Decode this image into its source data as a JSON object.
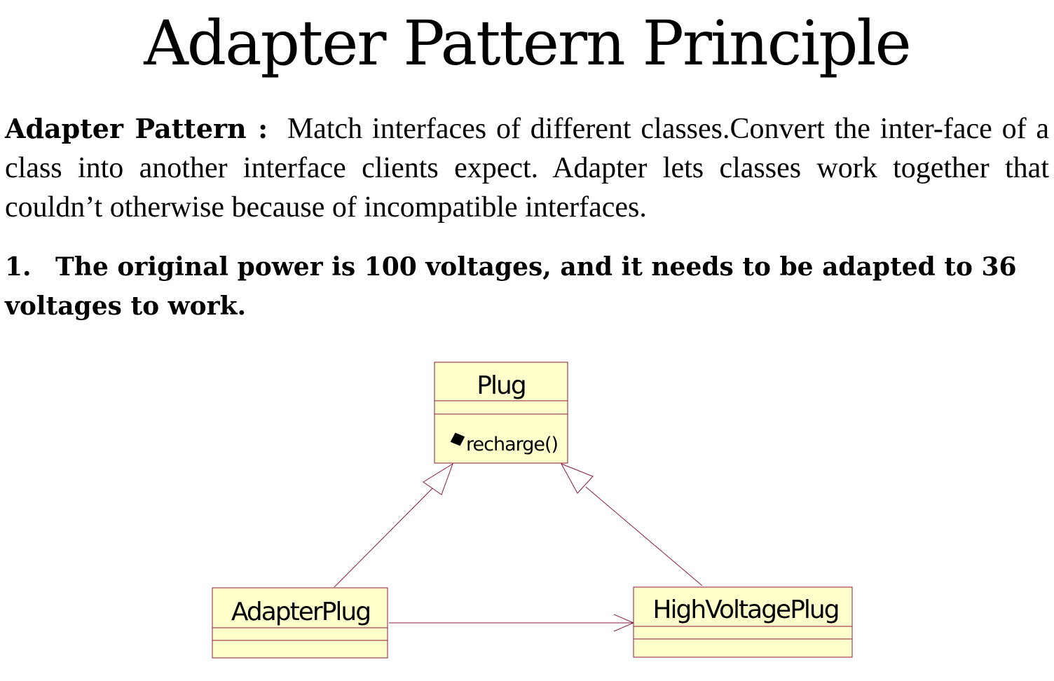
{
  "title": "Adapter Pattern Principle",
  "definition": {
    "term": "Adapter Pattern :",
    "text": "Match interfaces of different classes.Convert the inter-­face of a class into another interface clients expect. Adapter lets classes work together that couldn’t otherwise because of incompatible interfaces."
  },
  "point": {
    "number": "1.",
    "text": "The original power is 100 voltages, and it needs to be adapted to 36 voltages to work."
  },
  "diagram": {
    "classes": {
      "plug": {
        "name": "Plug",
        "operation": "recharge()"
      },
      "adapter": {
        "name": "AdapterPlug"
      },
      "high_voltage": {
        "name": "HighVoltagePlug"
      }
    },
    "relations": [
      {
        "from": "AdapterPlug",
        "to": "Plug",
        "type": "generalization"
      },
      {
        "from": "HighVoltagePlug",
        "to": "Plug",
        "type": "generalization"
      },
      {
        "from": "AdapterPlug",
        "to": "HighVoltagePlug",
        "type": "association"
      }
    ],
    "colors": {
      "class_fill": "#ffffcc",
      "class_border": "#8b1a3a",
      "line": "#8b1a3a"
    }
  }
}
